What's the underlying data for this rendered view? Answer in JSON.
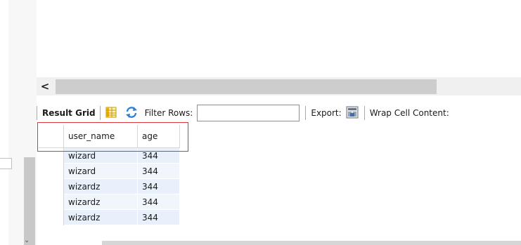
{
  "toolbar": {
    "result_grid_label": "Result Grid",
    "filter_rows_label": "Filter Rows:",
    "filter_value": "",
    "export_label": "Export:",
    "wrap_cell_label": "Wrap Cell Content:"
  },
  "grid": {
    "columns": [
      "user_name",
      "age"
    ],
    "rows": [
      {
        "user_name": "wizard",
        "age": "344"
      },
      {
        "user_name": "wizard",
        "age": "344"
      },
      {
        "user_name": "wizardz",
        "age": "344"
      },
      {
        "user_name": "wizardz",
        "age": "344"
      },
      {
        "user_name": "wizardz",
        "age": "344"
      }
    ]
  },
  "icons": {
    "scroll_left": "chevron-left-icon",
    "grid": "grid-layout-icon",
    "refresh": "refresh-icon",
    "export": "export-icon"
  },
  "colors": {
    "highlight": "#d9363e",
    "row_fill": "#e8f0fb",
    "refresh_blue": "#2f7fd6",
    "grid_yellow": "#f0b400"
  }
}
